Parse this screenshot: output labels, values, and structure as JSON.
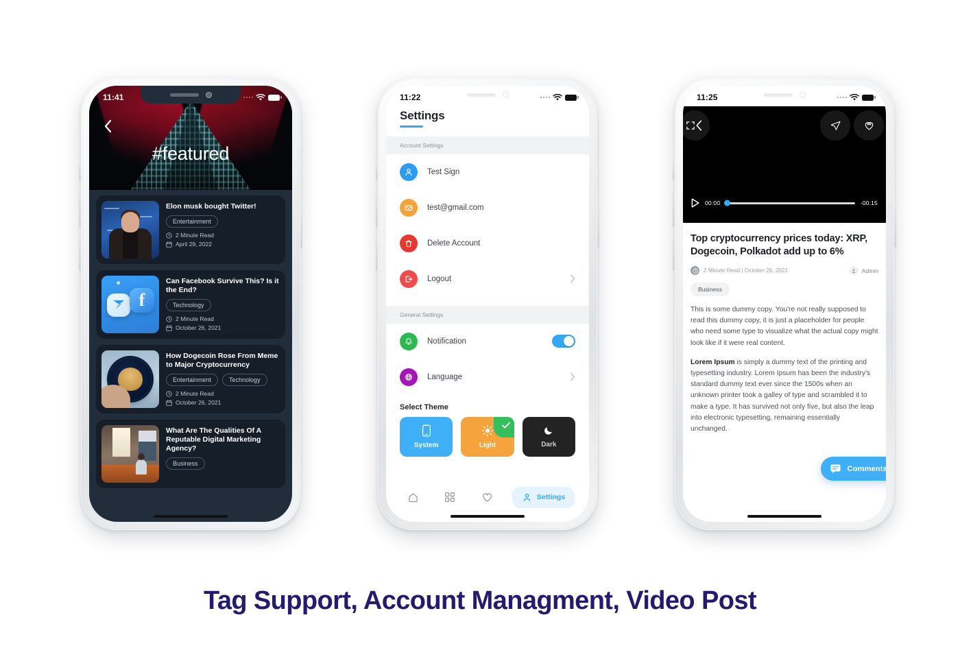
{
  "caption": "Tag Support, Account Managment, Video Post",
  "accent": {
    "blue": "#35a8f4",
    "navy": "#241a6e",
    "green": "#32bf5c",
    "orange": "#f5a33c",
    "red": "#f0453f",
    "purple": "#a414b8"
  },
  "phone1": {
    "status": {
      "time": "11:41"
    },
    "hero": {
      "title": "#featured",
      "back_icon": "chevron-left-icon"
    },
    "articles": [
      {
        "title": "Elon musk bought Twitter!",
        "tags": [
          "Entertainment"
        ],
        "read_time": "2 Minute Read",
        "date": "April 29, 2022",
        "thumb": "elon-musk-thumbnail"
      },
      {
        "title": "Can Facebook Survive This? Is it the End?",
        "tags": [
          "Technology"
        ],
        "read_time": "2 Minute Read",
        "date": "October 26, 2021",
        "thumb": "facebook-messenger-thumbnail"
      },
      {
        "title": "How Dogecoin Rose From Meme to Major Cryptocurrency",
        "tags": [
          "Entertainment",
          "Technology"
        ],
        "read_time": "2 Minute Read",
        "date": "October 26, 2021",
        "thumb": "dogecoin-thumbnail"
      },
      {
        "title": "What Are The Qualities Of A Reputable Digital Marketing Agency?",
        "tags": [
          "Business"
        ],
        "read_time": "",
        "date": "",
        "thumb": "office-meeting-thumbnail"
      }
    ]
  },
  "phone2": {
    "status": {
      "time": "11:22"
    },
    "title": "Settings",
    "sections": [
      {
        "label": "Account Settings"
      },
      {
        "label": "General Settings"
      }
    ],
    "account_rows": [
      {
        "label": "Test Sign",
        "icon": "user-icon",
        "color": "#2b9cf0",
        "chevron": false,
        "toggle": false
      },
      {
        "label": "test@gmail.com",
        "icon": "mail-icon",
        "color": "#f5a33c",
        "chevron": false,
        "toggle": false
      },
      {
        "label": "Delete Account",
        "icon": "trash-icon",
        "color": "#e8372e",
        "chevron": false,
        "toggle": false
      },
      {
        "label": "Logout",
        "icon": "logout-icon",
        "color": "#f04b4b",
        "chevron": true,
        "toggle": false
      }
    ],
    "general_rows": [
      {
        "label": "Notification",
        "icon": "bell-icon",
        "color": "#2fb84f",
        "chevron": false,
        "toggle": true,
        "toggle_on": true
      },
      {
        "label": "Language",
        "icon": "globe-icon",
        "color": "#a414b8",
        "chevron": true,
        "toggle": false
      }
    ],
    "theme": {
      "title": "Select Theme",
      "options": [
        {
          "label": "System",
          "icon": "phone-icon",
          "bg": "#3fb0f7",
          "selected": false
        },
        {
          "label": "Light",
          "icon": "sun-icon",
          "bg": "#f5a33c",
          "selected": true
        },
        {
          "label": "Dark",
          "icon": "moon-icon",
          "bg": "#232323",
          "selected": false
        }
      ]
    },
    "tabs": [
      {
        "label": "",
        "icon": "home-icon",
        "active": false
      },
      {
        "label": "",
        "icon": "grid-icon",
        "active": false
      },
      {
        "label": "",
        "icon": "heart-icon",
        "active": false
      },
      {
        "label": "Settings",
        "icon": "user-icon",
        "active": true
      }
    ]
  },
  "phone3": {
    "status": {
      "time": "11:25"
    },
    "video": {
      "expand_icon": "fullscreen-icon",
      "back_icon": "chevron-left-icon",
      "share_icon": "send-icon",
      "save_icon": "bookmark-heart-icon",
      "play_icon": "play-icon",
      "current_time": "00:00",
      "remaining_time": "-00:15",
      "progress_percent": 0
    },
    "title": "Top cryptocurrency prices today: XRP, Dogecoin, Polkadot add up to 6%",
    "meta": "2 Minute Read | October 26, 2021",
    "author": "Admin",
    "tag": "Business",
    "paragraphs": [
      "This is some dummy copy. You're not really supposed to read this dummy copy, it is just a placeholder for people who need some type to visualize what the actual copy might look like if it were real content.",
      "Lorem Ipsum is simply a dummy text of the printing and typesetting industry. Lorem Ipsum has been the industry's standard dummy text ever since the 1500s when an unknown printer took a galley of type and scrambled it to make a type. It has survived not only five, but also the leap into electronic typesetting, remaining essentially unchanged."
    ],
    "lead_bold": "Lorem Ipsum",
    "comments_label": "Comments"
  }
}
